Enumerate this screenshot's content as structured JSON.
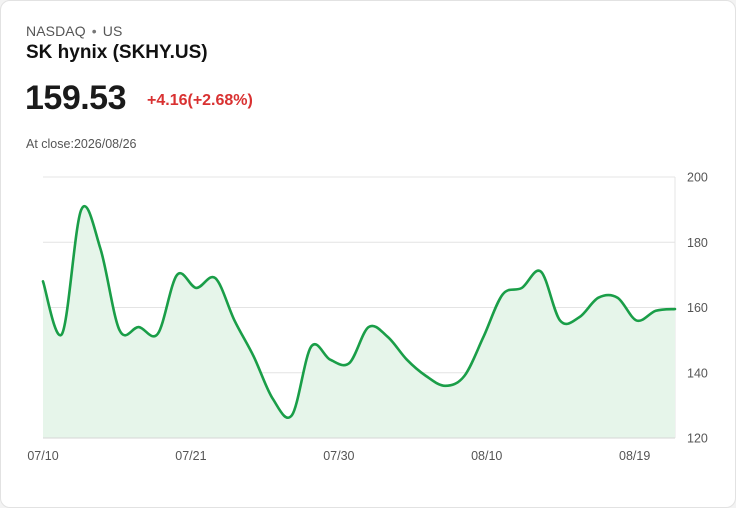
{
  "header": {
    "exchange": "NASDAQ",
    "separator": "•",
    "region": "US",
    "title": "SK hynix (SKHY.US)",
    "price": "159.53",
    "change": "+4.16(+2.68%)",
    "close_prefix": "At close:",
    "close_date": "2026/08/26"
  },
  "colors": {
    "line": "#1a9e48",
    "fill": "#e6f5ea",
    "change": "#d93131",
    "grid": "#e4e4e4"
  },
  "chart_data": {
    "type": "area",
    "title": "",
    "xlabel": "",
    "ylabel": "",
    "ylim": [
      120,
      200
    ],
    "yticks": [
      200,
      180,
      160,
      140,
      120
    ],
    "ytick_side": "right",
    "grid": true,
    "x_tick_labels": [
      {
        "label": "07/10",
        "index": 0
      },
      {
        "label": "07/21",
        "index": 11
      },
      {
        "label": "07/30",
        "index": 22
      },
      {
        "label": "08/10",
        "index": 33
      },
      {
        "label": "08/19",
        "index": 44
      }
    ],
    "series": [
      {
        "values": [
          168,
          152,
          190,
          178,
          153,
          154,
          152,
          170,
          166,
          169,
          156,
          145,
          132,
          127,
          148,
          144,
          143,
          154,
          151,
          144,
          139,
          136,
          139,
          151,
          164,
          166,
          171,
          156,
          157,
          163,
          163,
          156,
          159,
          159.53
        ]
      }
    ]
  }
}
